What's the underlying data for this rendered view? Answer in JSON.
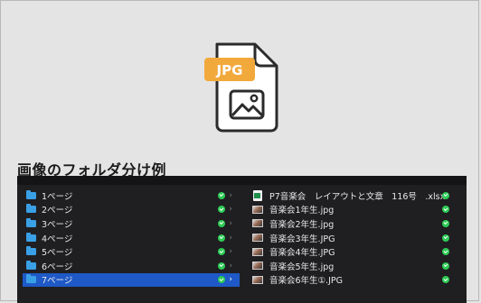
{
  "caption": "画像のフォルダ分け例",
  "icon": {
    "badge_text": "JPG",
    "badge_color": "#f2a93b",
    "name": "jpg-file-icon"
  },
  "folders": [
    {
      "label": "1ページ",
      "selected": false
    },
    {
      "label": "2ページ",
      "selected": false
    },
    {
      "label": "3ページ",
      "selected": false
    },
    {
      "label": "4ページ",
      "selected": false
    },
    {
      "label": "5ページ",
      "selected": false
    },
    {
      "label": "6ページ",
      "selected": false
    },
    {
      "label": "7ページ",
      "selected": true
    }
  ],
  "files": [
    {
      "label": "P7音楽会　レイアウトと文章　116号　.xlsx",
      "type": "xlsx"
    },
    {
      "label": "音楽会1年生.jpg",
      "type": "image"
    },
    {
      "label": "音楽会2年生.jpg",
      "type": "image"
    },
    {
      "label": "音楽会3年生.JPG",
      "type": "image"
    },
    {
      "label": "音楽会4年生.JPG",
      "type": "image"
    },
    {
      "label": "音楽会5年生.jpg",
      "type": "image"
    },
    {
      "label": "音楽会6年生①.JPG",
      "type": "image"
    }
  ],
  "colors": {
    "selection": "#1e59c7",
    "sync_check": "#2ecc55",
    "folder": "#3aa0e6"
  }
}
